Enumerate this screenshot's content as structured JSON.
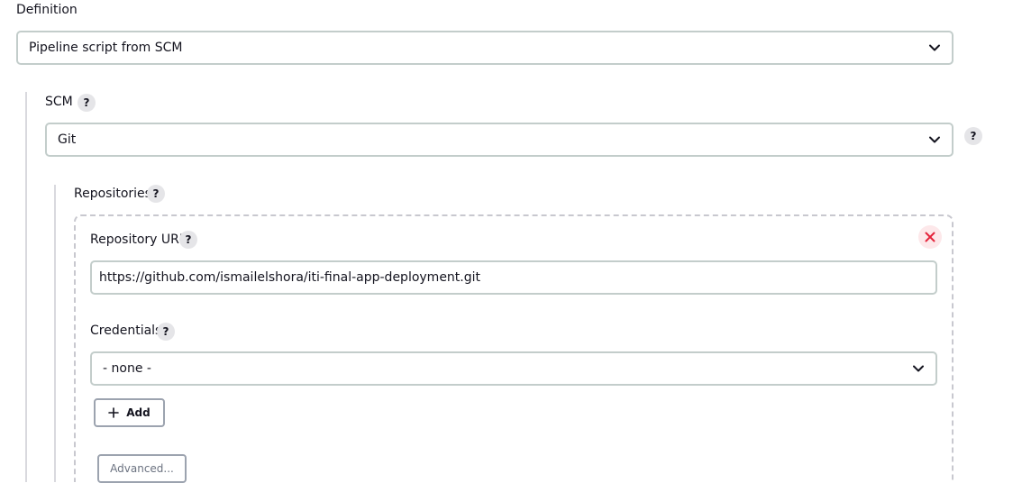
{
  "definition": {
    "label": "Definition",
    "selected": "Pipeline script from SCM"
  },
  "scm": {
    "label": "SCM",
    "help": "?",
    "selected": "Git",
    "side_help": "?"
  },
  "repositories": {
    "label": "Repositories",
    "help": "?",
    "repository_url": {
      "label": "Repository URL",
      "help": "?",
      "value": "https://github.com/ismailelshora/iti-final-app-deployment.git"
    },
    "credentials": {
      "label": "Credentials",
      "help": "?",
      "selected": "- none -"
    },
    "add_button": {
      "label": "Add"
    },
    "advanced_button": {
      "label": "Advanced..."
    }
  },
  "colors": {
    "close_icon": "#e5243b",
    "border": "#c3cdcb",
    "help_bg": "#e5e5e8"
  },
  "icons": [
    "chevron-down-icon",
    "help-icon",
    "close-icon",
    "plus-icon"
  ]
}
